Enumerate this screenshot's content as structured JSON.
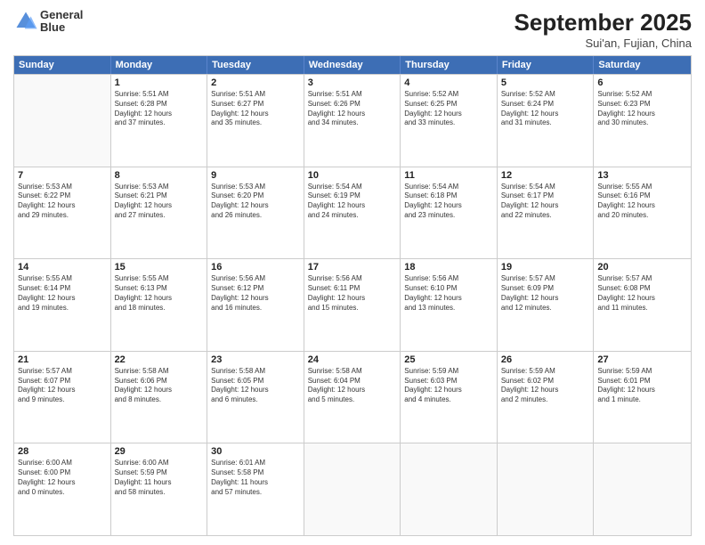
{
  "header": {
    "logo_line1": "General",
    "logo_line2": "Blue",
    "title": "September 2025",
    "subtitle": "Sui'an, Fujian, China"
  },
  "days": [
    "Sunday",
    "Monday",
    "Tuesday",
    "Wednesday",
    "Thursday",
    "Friday",
    "Saturday"
  ],
  "weeks": [
    [
      {
        "day": "",
        "text": ""
      },
      {
        "day": "1",
        "text": "Sunrise: 5:51 AM\nSunset: 6:28 PM\nDaylight: 12 hours\nand 37 minutes."
      },
      {
        "day": "2",
        "text": "Sunrise: 5:51 AM\nSunset: 6:27 PM\nDaylight: 12 hours\nand 35 minutes."
      },
      {
        "day": "3",
        "text": "Sunrise: 5:51 AM\nSunset: 6:26 PM\nDaylight: 12 hours\nand 34 minutes."
      },
      {
        "day": "4",
        "text": "Sunrise: 5:52 AM\nSunset: 6:25 PM\nDaylight: 12 hours\nand 33 minutes."
      },
      {
        "day": "5",
        "text": "Sunrise: 5:52 AM\nSunset: 6:24 PM\nDaylight: 12 hours\nand 31 minutes."
      },
      {
        "day": "6",
        "text": "Sunrise: 5:52 AM\nSunset: 6:23 PM\nDaylight: 12 hours\nand 30 minutes."
      }
    ],
    [
      {
        "day": "7",
        "text": "Sunrise: 5:53 AM\nSunset: 6:22 PM\nDaylight: 12 hours\nand 29 minutes."
      },
      {
        "day": "8",
        "text": "Sunrise: 5:53 AM\nSunset: 6:21 PM\nDaylight: 12 hours\nand 27 minutes."
      },
      {
        "day": "9",
        "text": "Sunrise: 5:53 AM\nSunset: 6:20 PM\nDaylight: 12 hours\nand 26 minutes."
      },
      {
        "day": "10",
        "text": "Sunrise: 5:54 AM\nSunset: 6:19 PM\nDaylight: 12 hours\nand 24 minutes."
      },
      {
        "day": "11",
        "text": "Sunrise: 5:54 AM\nSunset: 6:18 PM\nDaylight: 12 hours\nand 23 minutes."
      },
      {
        "day": "12",
        "text": "Sunrise: 5:54 AM\nSunset: 6:17 PM\nDaylight: 12 hours\nand 22 minutes."
      },
      {
        "day": "13",
        "text": "Sunrise: 5:55 AM\nSunset: 6:16 PM\nDaylight: 12 hours\nand 20 minutes."
      }
    ],
    [
      {
        "day": "14",
        "text": "Sunrise: 5:55 AM\nSunset: 6:14 PM\nDaylight: 12 hours\nand 19 minutes."
      },
      {
        "day": "15",
        "text": "Sunrise: 5:55 AM\nSunset: 6:13 PM\nDaylight: 12 hours\nand 18 minutes."
      },
      {
        "day": "16",
        "text": "Sunrise: 5:56 AM\nSunset: 6:12 PM\nDaylight: 12 hours\nand 16 minutes."
      },
      {
        "day": "17",
        "text": "Sunrise: 5:56 AM\nSunset: 6:11 PM\nDaylight: 12 hours\nand 15 minutes."
      },
      {
        "day": "18",
        "text": "Sunrise: 5:56 AM\nSunset: 6:10 PM\nDaylight: 12 hours\nand 13 minutes."
      },
      {
        "day": "19",
        "text": "Sunrise: 5:57 AM\nSunset: 6:09 PM\nDaylight: 12 hours\nand 12 minutes."
      },
      {
        "day": "20",
        "text": "Sunrise: 5:57 AM\nSunset: 6:08 PM\nDaylight: 12 hours\nand 11 minutes."
      }
    ],
    [
      {
        "day": "21",
        "text": "Sunrise: 5:57 AM\nSunset: 6:07 PM\nDaylight: 12 hours\nand 9 minutes."
      },
      {
        "day": "22",
        "text": "Sunrise: 5:58 AM\nSunset: 6:06 PM\nDaylight: 12 hours\nand 8 minutes."
      },
      {
        "day": "23",
        "text": "Sunrise: 5:58 AM\nSunset: 6:05 PM\nDaylight: 12 hours\nand 6 minutes."
      },
      {
        "day": "24",
        "text": "Sunrise: 5:58 AM\nSunset: 6:04 PM\nDaylight: 12 hours\nand 5 minutes."
      },
      {
        "day": "25",
        "text": "Sunrise: 5:59 AM\nSunset: 6:03 PM\nDaylight: 12 hours\nand 4 minutes."
      },
      {
        "day": "26",
        "text": "Sunrise: 5:59 AM\nSunset: 6:02 PM\nDaylight: 12 hours\nand 2 minutes."
      },
      {
        "day": "27",
        "text": "Sunrise: 5:59 AM\nSunset: 6:01 PM\nDaylight: 12 hours\nand 1 minute."
      }
    ],
    [
      {
        "day": "28",
        "text": "Sunrise: 6:00 AM\nSunset: 6:00 PM\nDaylight: 12 hours\nand 0 minutes."
      },
      {
        "day": "29",
        "text": "Sunrise: 6:00 AM\nSunset: 5:59 PM\nDaylight: 11 hours\nand 58 minutes."
      },
      {
        "day": "30",
        "text": "Sunrise: 6:01 AM\nSunset: 5:58 PM\nDaylight: 11 hours\nand 57 minutes."
      },
      {
        "day": "",
        "text": ""
      },
      {
        "day": "",
        "text": ""
      },
      {
        "day": "",
        "text": ""
      },
      {
        "day": "",
        "text": ""
      }
    ]
  ]
}
